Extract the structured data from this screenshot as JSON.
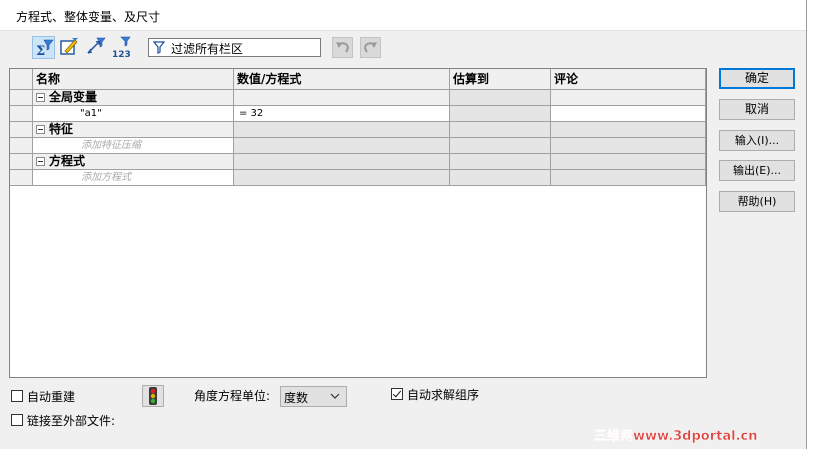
{
  "window": {
    "title": "方程式、整体变量、及尺寸"
  },
  "toolbar": {
    "filter_text": "过滤所有栏区",
    "buttons": [
      {
        "icon": "sigma-filter-icon"
      },
      {
        "icon": "equation-edit-icon"
      },
      {
        "icon": "dimension-filter-icon"
      },
      {
        "icon": "numeric-filter-icon"
      }
    ]
  },
  "grid": {
    "columns": [
      "名称",
      "数值/方程式",
      "估算到",
      "评论"
    ],
    "groups": {
      "global": {
        "title": "全局变量",
        "item_name": "\"a1\"",
        "item_value": "= 32"
      },
      "features": {
        "title": "特征",
        "hint": "添加特征压缩"
      },
      "equations": {
        "title": "方程式",
        "hint": "添加方程式"
      }
    }
  },
  "buttons": {
    "ok": "确定",
    "cancel": "取消",
    "import": "输入(I)...",
    "export": "输出(E)...",
    "help": "帮助(H)"
  },
  "bottom": {
    "auto_rebuild": "自动重建",
    "auto_rebuild_checked": false,
    "link_external": "链接至外部文件:",
    "link_external_checked": false,
    "angle_unit_label": "角度方程单位:",
    "angle_unit_value": "度数",
    "auto_solve": "自动求解组序",
    "auto_solve_checked": true
  },
  "watermark": "三维网www.3dportal.cn"
}
